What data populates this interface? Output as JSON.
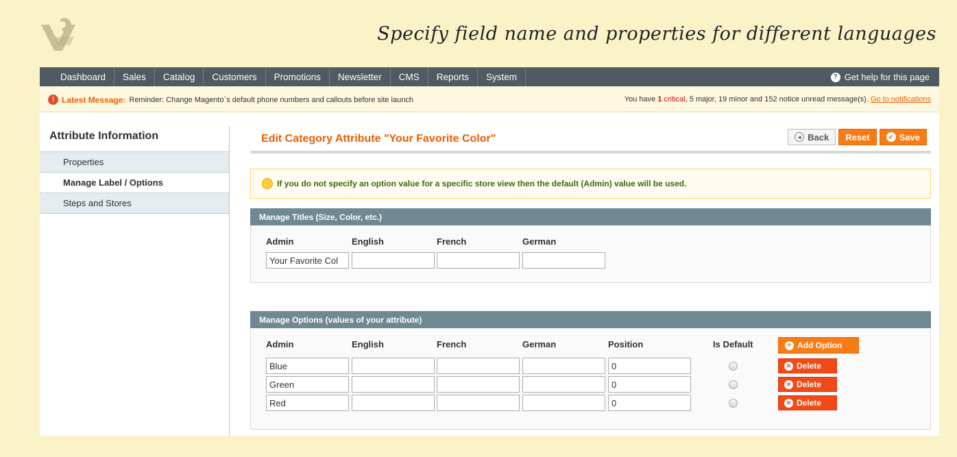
{
  "banner": "Specify field name and properties for different languages",
  "nav": {
    "items": [
      "Dashboard",
      "Sales",
      "Catalog",
      "Customers",
      "Promotions",
      "Newsletter",
      "CMS",
      "Reports",
      "System"
    ],
    "help": "Get help for this page"
  },
  "message": {
    "latest_label": "Latest Message:",
    "latest_text": "Reminder: Change Magento`s default phone numbers and callouts before site launch",
    "summary_prefix": "You have",
    "critical_count": "1",
    "critical_label": "critical",
    "rest": ", 5 major, 19 minor and 152 notice unread message(s).",
    "link": "Go to notifications"
  },
  "sidebar": {
    "title": "Attribute Information",
    "items": [
      "Properties",
      "Manage Label / Options",
      "Steps and Stores"
    ]
  },
  "main": {
    "title": "Edit Category Attribute \"Your Favorite Color\"",
    "back": "Back",
    "reset": "Reset",
    "save": "Save",
    "notice": "If you do not specify an option value for a specific store view then the default (Admin) value will be used."
  },
  "titles": {
    "header": "Manage Titles (Size, Color, etc.)",
    "columns": [
      "Admin",
      "English",
      "French",
      "German"
    ],
    "values": [
      "Your Favorite Col",
      "",
      "",
      ""
    ]
  },
  "options": {
    "header": "Manage Options (values of your attribute)",
    "columns": [
      "Admin",
      "English",
      "French",
      "German",
      "Position",
      "Is Default"
    ],
    "add_label": "Add Option",
    "delete_label": "Delete",
    "rows": [
      {
        "admin": "Blue",
        "english": "",
        "french": "",
        "german": "",
        "position": "0"
      },
      {
        "admin": "Green",
        "english": "",
        "french": "",
        "german": "",
        "position": "0"
      },
      {
        "admin": "Red",
        "english": "",
        "french": "",
        "german": "",
        "position": "0"
      }
    ]
  },
  "colors": {
    "accent": "#eb5e00",
    "nav": "#4f5a62",
    "section": "#6f8992",
    "delete": "#f04a18"
  }
}
